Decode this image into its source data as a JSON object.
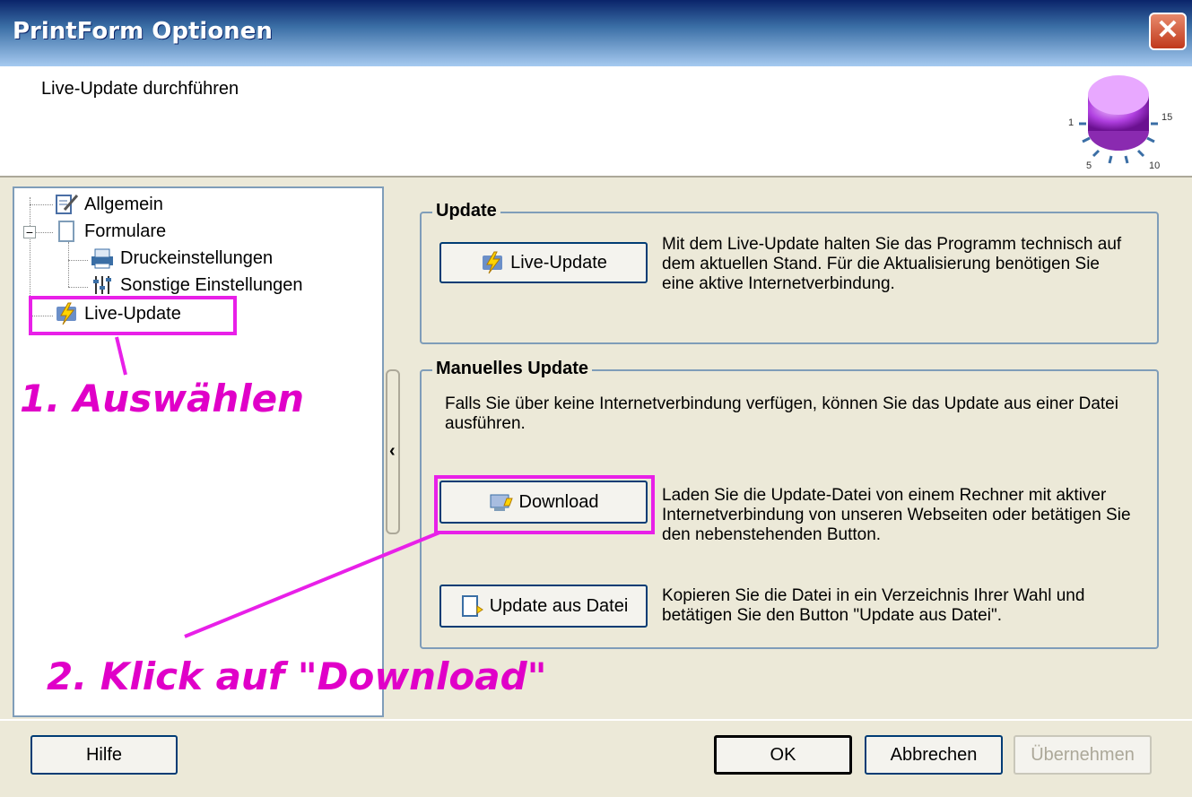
{
  "window": {
    "title": "PrintForm Optionen"
  },
  "header": {
    "subtitle": "Live-Update durchführen"
  },
  "knob": {
    "labels": [
      "1",
      "5",
      "10",
      "15"
    ]
  },
  "tree": {
    "items": [
      {
        "label": "Allgemein"
      },
      {
        "label": "Formulare"
      },
      {
        "label": "Druckeinstellungen"
      },
      {
        "label": "Sonstige Einstellungen"
      },
      {
        "label": "Live-Update"
      }
    ]
  },
  "update_group": {
    "legend": "Update",
    "button_label": "Live-Update",
    "description": "Mit dem Live-Update halten Sie das Programm technisch auf dem aktuellen Stand. Für die Aktualisierung benötigen Sie eine aktive Internetverbindung."
  },
  "manual_group": {
    "legend": "Manuelles Update",
    "intro": "Falls Sie über keine Internetverbindung verfügen, können Sie das Update aus einer Datei ausführen.",
    "download_label": "Download",
    "download_desc": "Laden Sie die Update-Datei von einem Rechner mit aktiver Internetverbindung von unseren Webseiten oder betätigen Sie den nebenstehenden Button.",
    "file_label": "Update aus Datei",
    "file_desc": "Kopieren Sie die Datei in ein Verzeichnis Ihrer Wahl und betätigen Sie den Button \"Update aus Datei\"."
  },
  "annotations": {
    "step1": "1. Auswählen",
    "step2": "2. Klick auf \"Download\"",
    "color": "#e000c8"
  },
  "footer": {
    "help": "Hilfe",
    "ok": "OK",
    "cancel": "Abbrechen",
    "apply": "Übernehmen"
  }
}
